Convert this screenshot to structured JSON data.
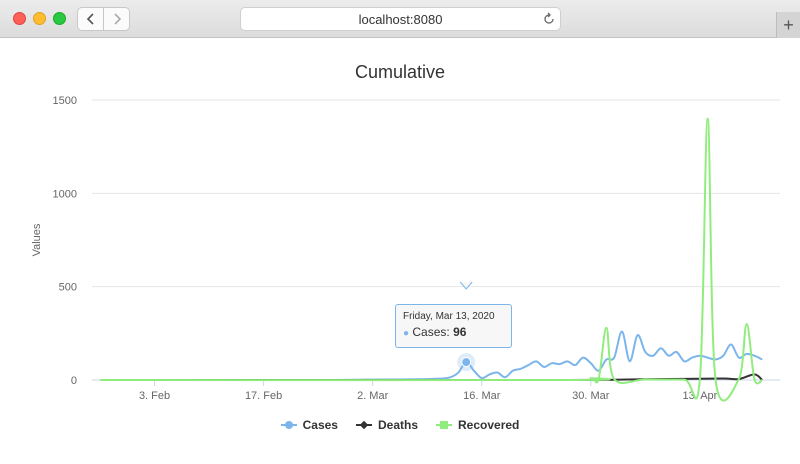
{
  "browser": {
    "address": "localhost:8080",
    "newtab_label": "+"
  },
  "chart_data": {
    "type": "line",
    "title": "Cumulative",
    "ylabel": "Values",
    "xlabel": "",
    "ylim": [
      0,
      1500
    ],
    "yticks": [
      0,
      500,
      1000,
      1500
    ],
    "x_start_date": "2020-01-27",
    "xticks": [
      {
        "label": "3. Feb",
        "day": 7
      },
      {
        "label": "17. Feb",
        "day": 21
      },
      {
        "label": "2. Mar",
        "day": 35
      },
      {
        "label": "16. Mar",
        "day": 49
      },
      {
        "label": "30. Mar",
        "day": 63
      },
      {
        "label": "13. Apr",
        "day": 77
      }
    ],
    "xlim_days": [
      0,
      86
    ],
    "series": [
      {
        "name": "Cases",
        "color": "#7cb5ec",
        "marker": "circle",
        "points": [
          [
            0,
            0
          ],
          [
            10,
            0
          ],
          [
            20,
            0
          ],
          [
            30,
            0
          ],
          [
            34,
            2
          ],
          [
            38,
            3
          ],
          [
            42,
            5
          ],
          [
            44,
            8
          ],
          [
            45,
            15
          ],
          [
            46,
            40
          ],
          [
            47,
            96
          ],
          [
            48,
            50
          ],
          [
            49,
            10
          ],
          [
            50,
            30
          ],
          [
            51,
            40
          ],
          [
            52,
            15
          ],
          [
            53,
            50
          ],
          [
            54,
            60
          ],
          [
            55,
            80
          ],
          [
            56,
            100
          ],
          [
            57,
            70
          ],
          [
            58,
            90
          ],
          [
            59,
            85
          ],
          [
            60,
            100
          ],
          [
            61,
            80
          ],
          [
            62,
            120
          ],
          [
            63,
            90
          ],
          [
            64,
            50
          ],
          [
            65,
            110
          ],
          [
            66,
            120
          ],
          [
            67,
            260
          ],
          [
            68,
            100
          ],
          [
            69,
            240
          ],
          [
            70,
            150
          ],
          [
            71,
            130
          ],
          [
            72,
            170
          ],
          [
            73,
            130
          ],
          [
            74,
            150
          ],
          [
            75,
            100
          ],
          [
            76,
            120
          ],
          [
            77,
            130
          ],
          [
            78,
            120
          ],
          [
            79,
            110
          ],
          [
            80,
            130
          ],
          [
            81,
            190
          ],
          [
            82,
            120
          ],
          [
            83,
            140
          ],
          [
            84,
            130
          ],
          [
            85,
            110
          ]
        ]
      },
      {
        "name": "Deaths",
        "color": "#333333",
        "marker": "diamond",
        "points": [
          [
            0,
            0
          ],
          [
            40,
            0
          ],
          [
            50,
            0
          ],
          [
            60,
            0
          ],
          [
            65,
            1
          ],
          [
            70,
            4
          ],
          [
            75,
            6
          ],
          [
            80,
            8
          ],
          [
            82,
            5
          ],
          [
            84,
            30
          ],
          [
            85,
            0
          ]
        ]
      },
      {
        "name": "Recovered",
        "color": "#90ed7d",
        "marker": "square",
        "points": [
          [
            0,
            0
          ],
          [
            60,
            0
          ],
          [
            63,
            10
          ],
          [
            64,
            5
          ],
          [
            65,
            280
          ],
          [
            66,
            5
          ],
          [
            70,
            3
          ],
          [
            75,
            2
          ],
          [
            77,
            5
          ],
          [
            78,
            1400
          ],
          [
            79,
            5
          ],
          [
            82,
            5
          ],
          [
            83,
            300
          ],
          [
            84,
            5
          ],
          [
            85,
            0
          ]
        ]
      }
    ],
    "tooltip": {
      "date": "Friday, Mar 13, 2020",
      "series": "Cases",
      "label": "Cases: ",
      "value": "96",
      "day": 47
    }
  }
}
